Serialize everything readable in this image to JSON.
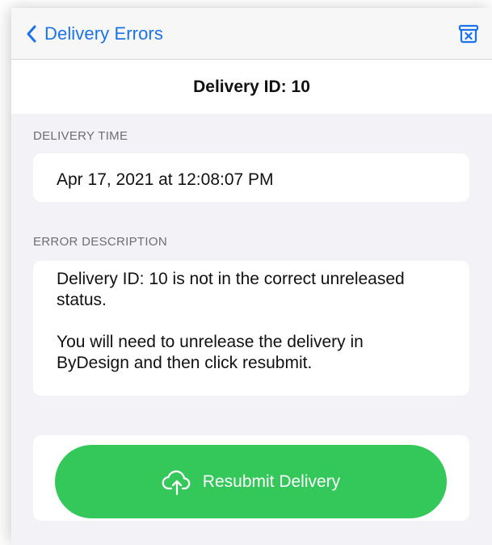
{
  "nav": {
    "back_label": "Delivery Errors",
    "back_icon": "chevron-left-icon",
    "action_icon": "archive-box-x-icon"
  },
  "header": {
    "title": "Delivery ID: 10"
  },
  "delivery_time": {
    "section_label": "DELIVERY TIME",
    "value": "Apr 17, 2021 at 12:08:07 PM"
  },
  "error_description": {
    "section_label": "ERROR DESCRIPTION",
    "text": "Delivery ID: 10 is not in the correct unreleased status.\n\nYou will need to unrelease the delivery in ByDesign and then click resubmit."
  },
  "actions": {
    "resubmit_label": "Resubmit Delivery",
    "resubmit_icon": "cloud-upload-icon"
  },
  "colors": {
    "accent_blue": "#1a73e8",
    "button_green": "#34c759",
    "background_gray": "#f2f2f7"
  }
}
